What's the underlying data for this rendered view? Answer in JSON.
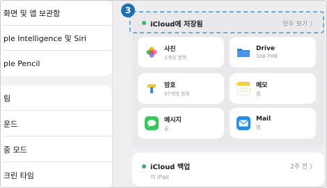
{
  "sidebar": {
    "group1": [
      "화면 및 앱 보관함",
      "ple Intelligence 및 Siri",
      "ple Pencil"
    ],
    "group2": [
      "림",
      "운드",
      "중 모드",
      "크린 타임"
    ]
  },
  "callout": {
    "number": "3"
  },
  "icloud_saved": {
    "title": "iCloud에 저장됨",
    "see_all": "모두 보기 〉",
    "tiles": [
      {
        "icon": "photos-icon",
        "title": "사진",
        "sub": "1개의 항목"
      },
      {
        "icon": "folder-icon",
        "title": "Drive",
        "sub": "308.7MB"
      },
      {
        "icon": "keychain-icon",
        "title": "암호",
        "sub": "37개의 항목"
      },
      {
        "icon": "notes-icon",
        "title": "메모",
        "sub": "켬"
      },
      {
        "icon": "messages-icon",
        "title": "메시지",
        "sub": "끔"
      },
      {
        "icon": "mail-icon",
        "title": "Mail",
        "sub": "켬"
      }
    ]
  },
  "backup": {
    "title": "iCloud 백업",
    "time": "2주 전 〉",
    "device": "이 iPad"
  },
  "colors": {
    "accent": "#1f6fb4",
    "status_dot": "#3bb36b",
    "highlight_border": "#6fa9d8"
  }
}
